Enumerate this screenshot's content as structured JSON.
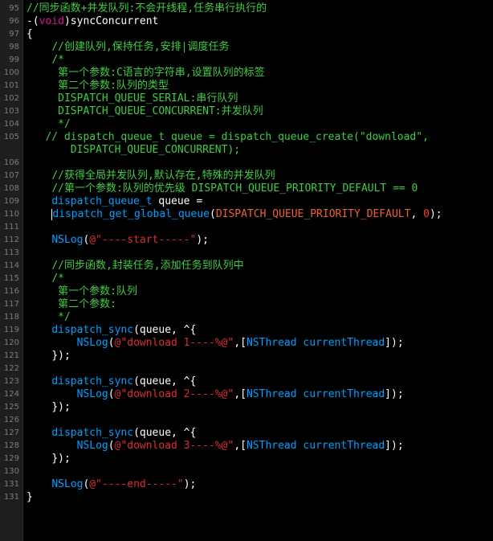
{
  "editor": {
    "lines": [
      {
        "num": "95",
        "indent": "",
        "tokens": [
          {
            "t": "//同步函数+并发队列:不会开线程,任务串行执行的",
            "c": "c-comment"
          }
        ]
      },
      {
        "num": "96",
        "indent": "",
        "tokens": [
          {
            "t": "-(",
            "c": "c-plain"
          },
          {
            "t": "void",
            "c": "c-kw"
          },
          {
            "t": ")syncConcurrent",
            "c": "c-plain"
          }
        ]
      },
      {
        "num": "97",
        "indent": "",
        "tokens": [
          {
            "t": "{",
            "c": "c-plain"
          }
        ]
      },
      {
        "num": "98",
        "indent": "    ",
        "tokens": [
          {
            "t": "//创建队列,保持任务,安排|调度任务",
            "c": "c-comment"
          }
        ]
      },
      {
        "num": "99",
        "indent": "    ",
        "tokens": [
          {
            "t": "/*",
            "c": "c-comment"
          }
        ]
      },
      {
        "num": "100",
        "indent": "     ",
        "tokens": [
          {
            "t": "第一个参数:C语言的字符串,设置队列的标签",
            "c": "c-comment"
          }
        ]
      },
      {
        "num": "101",
        "indent": "     ",
        "tokens": [
          {
            "t": "第二个参数:队列的类型",
            "c": "c-comment"
          }
        ]
      },
      {
        "num": "102",
        "indent": "     ",
        "tokens": [
          {
            "t": "DISPATCH_QUEUE_SERIAL:串行队列",
            "c": "c-comment"
          }
        ]
      },
      {
        "num": "103",
        "indent": "     ",
        "tokens": [
          {
            "t": "DISPATCH_QUEUE_CONCURRENT:并发队列",
            "c": "c-comment"
          }
        ]
      },
      {
        "num": "104",
        "indent": "     ",
        "tokens": [
          {
            "t": "*/",
            "c": "c-comment"
          }
        ]
      },
      {
        "num": "105",
        "indent": "   ",
        "tokens": [
          {
            "t": "// dispatch_queue_t queue = dispatch_queue_create(\"download\",",
            "c": "c-comment"
          }
        ]
      },
      {
        "num": "",
        "indent": "       ",
        "tokens": [
          {
            "t": "DISPATCH_QUEUE_CONCURRENT);",
            "c": "c-comment"
          }
        ]
      },
      {
        "num": "106",
        "indent": "",
        "tokens": []
      },
      {
        "num": "107",
        "indent": "    ",
        "tokens": [
          {
            "t": "//获得全局并发队列,默认存在,特殊的并发队列",
            "c": "c-comment"
          }
        ]
      },
      {
        "num": "108",
        "indent": "    ",
        "tokens": [
          {
            "t": "//第一个参数:队列的优先级 DISPATCH_QUEUE_PRIORITY_DEFAULT == 0",
            "c": "c-comment"
          }
        ]
      },
      {
        "num": "109",
        "indent": "    ",
        "tokens": [
          {
            "t": "dispatch_queue_t",
            "c": "c-type"
          },
          {
            "t": " queue =",
            "c": "c-plain"
          }
        ]
      },
      {
        "num": "110",
        "indent": "    ",
        "caret": true,
        "tokens": [
          {
            "t": "dispatch_get_global_queue",
            "c": "c-fn"
          },
          {
            "t": "(",
            "c": "c-plain"
          },
          {
            "t": "DISPATCH_QUEUE_PRIORITY_DEFAULT",
            "c": "c-macro"
          },
          {
            "t": ", ",
            "c": "c-plain"
          },
          {
            "t": "0",
            "c": "c-num"
          },
          {
            "t": ");",
            "c": "c-plain"
          }
        ]
      },
      {
        "num": "111",
        "indent": "",
        "tokens": []
      },
      {
        "num": "112",
        "indent": "    ",
        "tokens": [
          {
            "t": "NSLog",
            "c": "c-fn"
          },
          {
            "t": "(",
            "c": "c-plain"
          },
          {
            "t": "@\"----start-----\"",
            "c": "c-str"
          },
          {
            "t": ");",
            "c": "c-plain"
          }
        ]
      },
      {
        "num": "113",
        "indent": "",
        "tokens": []
      },
      {
        "num": "114",
        "indent": "    ",
        "tokens": [
          {
            "t": "//同步函数,封装任务,添加任务到队列中",
            "c": "c-comment"
          }
        ]
      },
      {
        "num": "115",
        "indent": "    ",
        "tokens": [
          {
            "t": "/*",
            "c": "c-comment"
          }
        ]
      },
      {
        "num": "116",
        "indent": "     ",
        "tokens": [
          {
            "t": "第一个参数:队列",
            "c": "c-comment"
          }
        ]
      },
      {
        "num": "117",
        "indent": "     ",
        "tokens": [
          {
            "t": "第二个参数:",
            "c": "c-comment"
          }
        ]
      },
      {
        "num": "118",
        "indent": "     ",
        "tokens": [
          {
            "t": "*/",
            "c": "c-comment"
          }
        ]
      },
      {
        "num": "119",
        "indent": "    ",
        "tokens": [
          {
            "t": "dispatch_sync",
            "c": "c-fn"
          },
          {
            "t": "(queue, ^{",
            "c": "c-plain"
          }
        ]
      },
      {
        "num": "120",
        "indent": "        ",
        "tokens": [
          {
            "t": "NSLog",
            "c": "c-fn"
          },
          {
            "t": "(",
            "c": "c-plain"
          },
          {
            "t": "@\"download 1----%@\"",
            "c": "c-str"
          },
          {
            "t": ",[",
            "c": "c-plain"
          },
          {
            "t": "NSThread",
            "c": "c-type"
          },
          {
            "t": " ",
            "c": "c-plain"
          },
          {
            "t": "currentThread",
            "c": "c-fn"
          },
          {
            "t": "]);",
            "c": "c-plain"
          }
        ]
      },
      {
        "num": "121",
        "indent": "    ",
        "tokens": [
          {
            "t": "});",
            "c": "c-plain"
          }
        ]
      },
      {
        "num": "122",
        "indent": "",
        "tokens": []
      },
      {
        "num": "123",
        "indent": "    ",
        "tokens": [
          {
            "t": "dispatch_sync",
            "c": "c-fn"
          },
          {
            "t": "(queue, ^{",
            "c": "c-plain"
          }
        ]
      },
      {
        "num": "124",
        "indent": "        ",
        "tokens": [
          {
            "t": "NSLog",
            "c": "c-fn"
          },
          {
            "t": "(",
            "c": "c-plain"
          },
          {
            "t": "@\"download 2----%@\"",
            "c": "c-str"
          },
          {
            "t": ",[",
            "c": "c-plain"
          },
          {
            "t": "NSThread",
            "c": "c-type"
          },
          {
            "t": " ",
            "c": "c-plain"
          },
          {
            "t": "currentThread",
            "c": "c-fn"
          },
          {
            "t": "]);",
            "c": "c-plain"
          }
        ]
      },
      {
        "num": "125",
        "indent": "    ",
        "tokens": [
          {
            "t": "});",
            "c": "c-plain"
          }
        ]
      },
      {
        "num": "126",
        "indent": "",
        "tokens": []
      },
      {
        "num": "127",
        "indent": "    ",
        "tokens": [
          {
            "t": "dispatch_sync",
            "c": "c-fn"
          },
          {
            "t": "(queue, ^{",
            "c": "c-plain"
          }
        ]
      },
      {
        "num": "128",
        "indent": "        ",
        "tokens": [
          {
            "t": "NSLog",
            "c": "c-fn"
          },
          {
            "t": "(",
            "c": "c-plain"
          },
          {
            "t": "@\"download 3----%@\"",
            "c": "c-str"
          },
          {
            "t": ",[",
            "c": "c-plain"
          },
          {
            "t": "NSThread",
            "c": "c-type"
          },
          {
            "t": " ",
            "c": "c-plain"
          },
          {
            "t": "currentThread",
            "c": "c-fn"
          },
          {
            "t": "]);",
            "c": "c-plain"
          }
        ]
      },
      {
        "num": "129",
        "indent": "    ",
        "tokens": [
          {
            "t": "});",
            "c": "c-plain"
          }
        ]
      },
      {
        "num": "130",
        "indent": "",
        "tokens": []
      },
      {
        "num": "131",
        "indent": "    ",
        "tokens": [
          {
            "t": "NSLog",
            "c": "c-fn"
          },
          {
            "t": "(",
            "c": "c-plain"
          },
          {
            "t": "@\"----end-----\"",
            "c": "c-str"
          },
          {
            "t": ");",
            "c": "c-plain"
          }
        ]
      },
      {
        "num": "131",
        "indent": "",
        "tokens": [
          {
            "t": "}",
            "c": "c-plain"
          }
        ]
      }
    ]
  },
  "colors": {
    "background": "#000000",
    "gutter": "#1e1e1e",
    "comment": "#41cc45",
    "keyword": "#d31895",
    "string": "#db2c38",
    "type": "#00a0ff",
    "number": "#ff3b30",
    "macro": "#e86234"
  }
}
